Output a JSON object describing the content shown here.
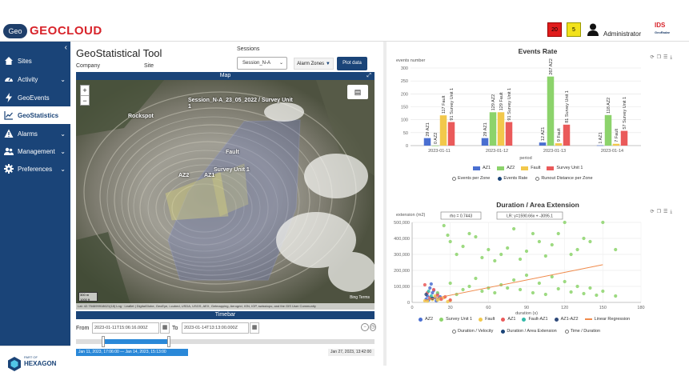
{
  "header": {
    "logo_badge": "Geo",
    "logo_text": "GEOCLOUD",
    "logo_sub": "· · · ·",
    "alarm_count_red": "20",
    "alarm_count_yellow": "5",
    "user_name": "Administrator",
    "partner_logo": "IDS",
    "partner_logo_sub": "GeoRadar"
  },
  "sidebar": {
    "items": [
      {
        "label": "Sites",
        "icon": "home-icon"
      },
      {
        "label": "Activity",
        "icon": "gauge-icon"
      },
      {
        "label": "GeoEvents",
        "icon": "bolt-icon"
      },
      {
        "label": "GeoStatistics",
        "icon": "chart-line-icon"
      },
      {
        "label": "Alarms",
        "icon": "warning-icon"
      },
      {
        "label": "Management",
        "icon": "users-icon"
      },
      {
        "label": "Preferences",
        "icon": "gear-icon"
      }
    ],
    "footer_small": "PART OF",
    "footer_big": "HEXAGON"
  },
  "tool": {
    "title": "GeoStatistical Tool",
    "company_label": "Company",
    "site_label": "Site",
    "sessions_label": "Sessions",
    "session_value": "Session_N-A",
    "alarm_zones_label": "Alarm Zones",
    "plot_data_label": "Plot data"
  },
  "map": {
    "header": "Map",
    "labels": {
      "session": "Session_N-A_23_05_2022 / Survey Unit",
      "session_2": "1",
      "rockspot": "Rockspot",
      "fault": "Fault",
      "az2": "AZ2",
      "az1": "AZ1",
      "survey_unit": "Survey Unit 1"
    },
    "scale_1": "300 m",
    "scale_2": "1000 ft",
    "bing": "Bing Terms",
    "attribution": "Lat: 42.754699918621(18) Lng · Leaflet | DigitalGlobe, GeoEye, i-cubed, USDA, USGS, AEX, Getmapping, Aerogrid, IGN, IGP, swisstopo, and the GIS User Community"
  },
  "timebar": {
    "header": "Timebar",
    "from_label": "From",
    "from_value": "2023-01-11T15:06:16.000Z",
    "to_label": "To",
    "to_value": "2023-01-14T13:13:00.000Z",
    "range_label": "Jan 11, 2023, 17:06:00 — Jan 14, 2023, 15:13:00",
    "end_label": "Jan 27, 2023, 13:42:00",
    "selection_start": 0.09,
    "selection_end": 0.31
  },
  "events_rate": {
    "title": "Events Rate",
    "radios": [
      {
        "label": "Events per Zone",
        "selected": false
      },
      {
        "label": "Events Rate",
        "selected": true
      },
      {
        "label": "Runout Distance per Zone",
        "selected": false
      }
    ]
  },
  "duration": {
    "title": "Duration / Area Extension",
    "rho": "rho = 0.7443",
    "lr": "LR: y=1590.66x + -3095.1",
    "radios": [
      {
        "label": "Duration / Velocity",
        "selected": false
      },
      {
        "label": "Duration / Area Extension",
        "selected": true
      },
      {
        "label": "Time / Duration",
        "selected": false
      }
    ]
  },
  "chart_data": [
    {
      "type": "bar",
      "title": "Events Rate",
      "xlabel": "period",
      "ylabel": "events number",
      "ylim": [
        0,
        300
      ],
      "yticks": [
        0,
        50,
        100,
        150,
        200,
        250,
        300
      ],
      "categories": [
        "2023-01-11",
        "2023-01-12",
        "2023-01-13",
        "2023-01-14"
      ],
      "series": [
        {
          "name": "AZ1",
          "color": "#4a6fd1",
          "values": [
            29,
            29,
            12,
            1
          ]
        },
        {
          "name": "AZ2",
          "color": "#8cd36b",
          "values": [
            0,
            129,
            267,
            118
          ]
        },
        {
          "name": "Fault",
          "color": "#f2c84b",
          "values": [
            117,
            129,
            9,
            7
          ]
        },
        {
          "name": "Survey Unit 1",
          "color": "#ea5a5a",
          "values": [
            91,
            91,
            81,
            57
          ]
        }
      ],
      "legend": "bottom"
    },
    {
      "type": "scatter",
      "title": "Duration / Area Extension",
      "xlabel": "duration (s)",
      "ylabel": "extension (m2)",
      "xlim": [
        0,
        180
      ],
      "ylim": [
        0,
        500000
      ],
      "xticks": [
        0,
        30,
        60,
        90,
        120,
        150,
        180
      ],
      "yticks": [
        0,
        100000,
        200000,
        300000,
        400000,
        500000
      ],
      "ytick_labels": [
        "0",
        "100,000",
        "200,000",
        "300,000",
        "400,000",
        "500,000"
      ],
      "series": [
        {
          "name": "AZ2",
          "color": "#4a6fd1",
          "points": [
            [
              12,
              40000
            ],
            [
              14,
              90000
            ],
            [
              15,
              115000
            ],
            [
              16,
              60000
            ],
            [
              18,
              30000
            ],
            [
              20,
              55000
            ],
            [
              11,
              20000
            ],
            [
              13,
              15000
            ],
            [
              22,
              35000
            ],
            [
              17,
              75000
            ],
            [
              19,
              10000
            ],
            [
              21,
              25000
            ]
          ]
        },
        {
          "name": "Survey Unit 1",
          "color": "#8cd36b",
          "points": [
            [
              25,
              480000
            ],
            [
              28,
              420000
            ],
            [
              30,
              380000
            ],
            [
              35,
              300000
            ],
            [
              40,
              350000
            ],
            [
              45,
              430000
            ],
            [
              50,
              410000
            ],
            [
              55,
              280000
            ],
            [
              60,
              330000
            ],
            [
              65,
              260000
            ],
            [
              70,
              300000
            ],
            [
              75,
              340000
            ],
            [
              80,
              460000
            ],
            [
              85,
              270000
            ],
            [
              90,
              320000
            ],
            [
              95,
              430000
            ],
            [
              100,
              380000
            ],
            [
              105,
              290000
            ],
            [
              110,
              360000
            ],
            [
              115,
              430000
            ],
            [
              120,
              500000
            ],
            [
              125,
              300000
            ],
            [
              130,
              330000
            ],
            [
              135,
              400000
            ],
            [
              140,
              380000
            ],
            [
              150,
              500000
            ],
            [
              160,
              330000
            ],
            [
              30,
              120000
            ],
            [
              40,
              80000
            ],
            [
              50,
              150000
            ],
            [
              60,
              90000
            ],
            [
              70,
              110000
            ],
            [
              80,
              140000
            ],
            [
              90,
              170000
            ],
            [
              100,
              120000
            ],
            [
              110,
              160000
            ],
            [
              120,
              130000
            ],
            [
              130,
              100000
            ],
            [
              140,
              90000
            ],
            [
              150,
              70000
            ],
            [
              160,
              40000
            ],
            [
              20,
              60000
            ],
            [
              35,
              50000
            ],
            [
              45,
              100000
            ],
            [
              55,
              70000
            ],
            [
              65,
              60000
            ],
            [
              75,
              90000
            ],
            [
              85,
              80000
            ],
            [
              95,
              60000
            ],
            [
              105,
              50000
            ],
            [
              115,
              85000
            ],
            [
              125,
              65000
            ],
            [
              135,
              55000
            ],
            [
              145,
              45000
            ]
          ]
        },
        {
          "name": "Fault",
          "color": "#f2c84b",
          "points": [
            [
              10,
              10000
            ],
            [
              15,
              25000
            ],
            [
              20,
              15000
            ],
            [
              25,
              30000
            ],
            [
              28,
              5000
            ],
            [
              18,
              40000
            ],
            [
              22,
              20000
            ],
            [
              12,
              8000
            ],
            [
              30,
              12000
            ],
            [
              16,
              18000
            ]
          ]
        },
        {
          "name": "AZ1",
          "color": "#ea5a5a",
          "points": [
            [
              10,
              110000
            ],
            [
              12,
              60000
            ],
            [
              14,
              30000
            ],
            [
              17,
              80000
            ],
            [
              20,
              45000
            ],
            [
              23,
              20000
            ],
            [
              26,
              35000
            ],
            [
              30,
              15000
            ]
          ]
        },
        {
          "name": "Fault-AZ1",
          "color": "#33b8a8",
          "points": [
            [
              13,
              70000
            ],
            [
              15,
              40000
            ]
          ]
        },
        {
          "name": "AZ1-AZ2",
          "color": "#2f4a7a",
          "points": [
            [
              11,
              50000
            ],
            [
              16,
              25000
            ]
          ]
        }
      ],
      "regression": {
        "name": "Linear Regression",
        "color": "#f08a4b",
        "slope": 1590.66,
        "intercept": -3095.1
      },
      "legend": "bottom"
    }
  ]
}
